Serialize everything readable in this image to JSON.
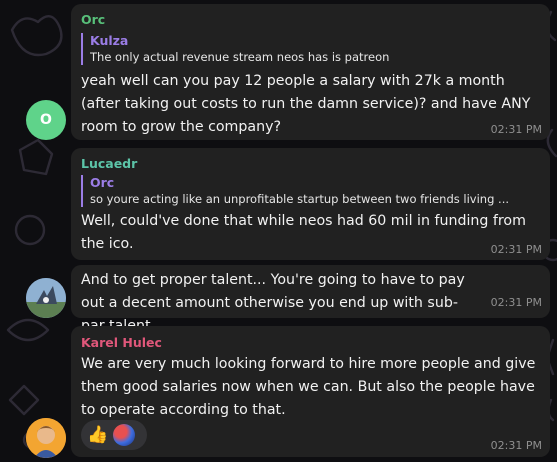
{
  "messages": [
    {
      "sender": "Orc",
      "sender_color": "#58c07a",
      "reply": {
        "name": "Kulza",
        "name_color": "#9b7de6",
        "text": "The only actual revenue stream neos has is patreon"
      },
      "text": "yeah well can you pay 12 people a salary with 27k a month (after taking out costs to run the damn service)? and have ANY room to grow the company?",
      "time": "02:31 PM",
      "avatar_initial": "O"
    },
    {
      "sender": "Lucaedr",
      "sender_color": "#5cc4a8",
      "reply": {
        "name": "Orc",
        "name_color": "#9b7de6",
        "text": "so youre acting like an unprofitable startup between two friends living ..."
      },
      "text": "Well, could've done that while neos had 60 mil in funding from the ico.",
      "time": "02:31 PM"
    },
    {
      "sender": "",
      "text": "And to get proper talent... You're going to have to pay out a decent amount otherwise you end up with sub-par talent.",
      "time": "02:31 PM"
    },
    {
      "sender": "Karel Hulec",
      "sender_color": "#e0577a",
      "text": "We are very much looking forward to hire more people and give them good salaries now when we can. But also the people have to operate according to that.",
      "time": "02:31 PM",
      "reactions": [
        {
          "emoji": "👍"
        }
      ]
    }
  ]
}
